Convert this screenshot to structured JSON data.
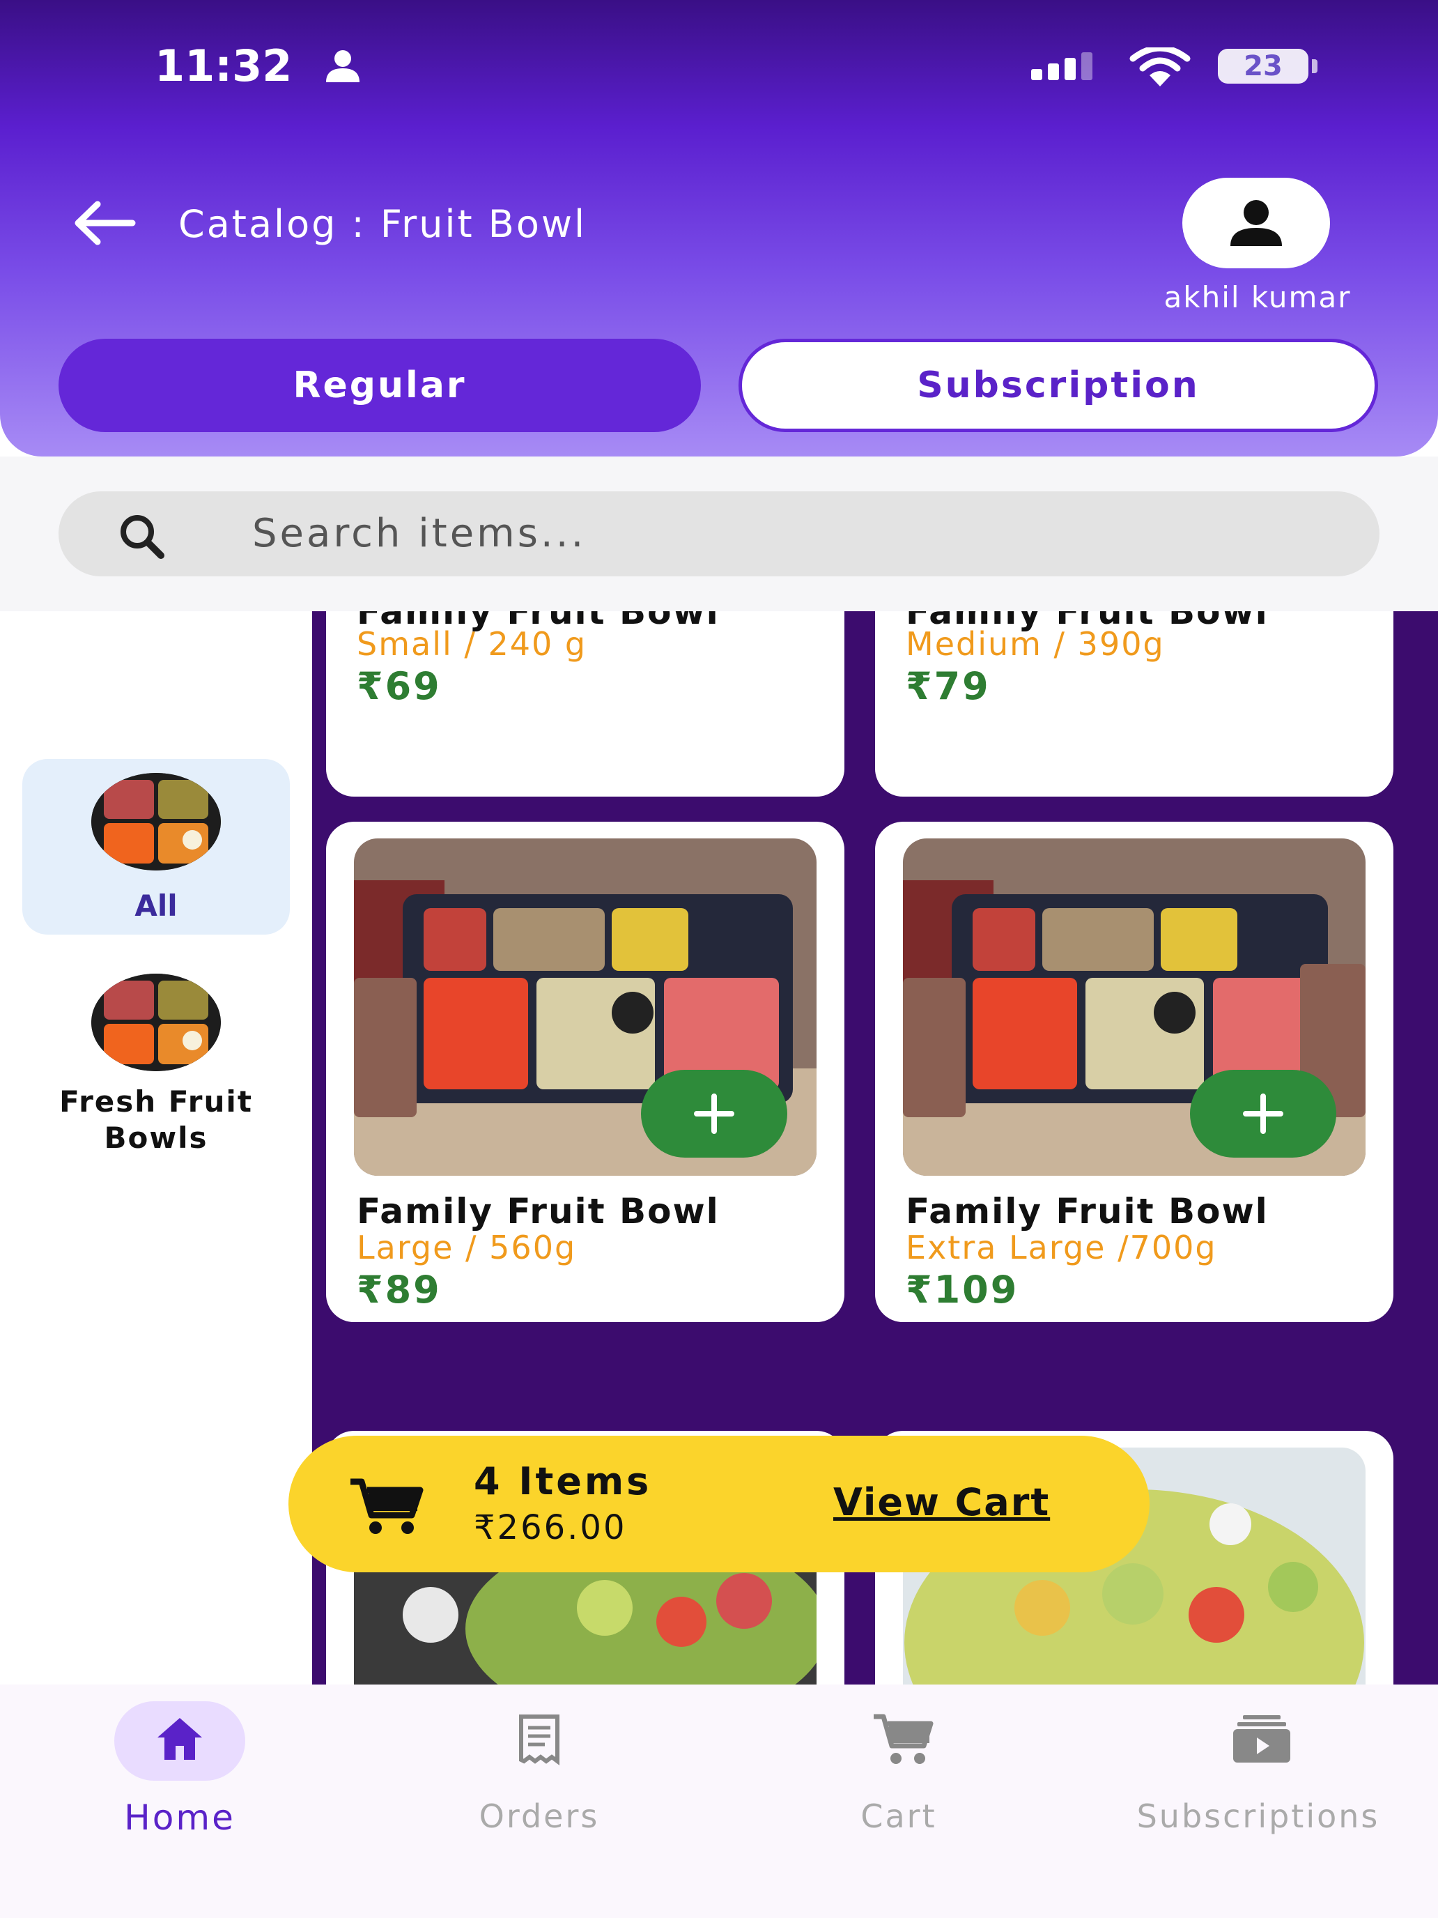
{
  "status_bar": {
    "time": "11:32",
    "battery": "23"
  },
  "header": {
    "title": "Catalog : Fruit Bowl",
    "user_name": "akhil kumar"
  },
  "mode_toggle": {
    "regular_label": "Regular",
    "subscription_label": "Subscription",
    "active": "Regular"
  },
  "search": {
    "placeholder": "Search items..."
  },
  "categories": [
    {
      "label": "All",
      "selected": true
    },
    {
      "label": "Fresh Fruit Bowls",
      "selected": false
    }
  ],
  "products": [
    {
      "title": "Family Fruit Bowl",
      "size": "Small / 240 g",
      "price": "₹69"
    },
    {
      "title": "Family Fruit Bowl",
      "size": "Medium / 390g",
      "price": "₹79"
    },
    {
      "title": "Family Fruit Bowl",
      "size": "Large / 560g",
      "price": "₹89"
    },
    {
      "title": "Family Fruit Bowl",
      "size": "Extra Large /700g",
      "price": "₹109"
    }
  ],
  "cart_bar": {
    "count": "4 Items",
    "total": "₹266.00",
    "action": "View Cart"
  },
  "bottom_nav": [
    {
      "label": "Home",
      "icon": "home-icon",
      "active": true
    },
    {
      "label": "Orders",
      "icon": "receipt-icon",
      "active": false
    },
    {
      "label": "Cart",
      "icon": "cart-icon",
      "active": false
    },
    {
      "label": "Subscriptions",
      "icon": "subscriptions-icon",
      "active": false
    }
  ],
  "colors": {
    "primary": "#6427d8",
    "accent_yellow": "#fbd42b",
    "price_green": "#2e7d32",
    "size_orange": "#f09a1c",
    "grid_bg": "#3c0c6e"
  }
}
